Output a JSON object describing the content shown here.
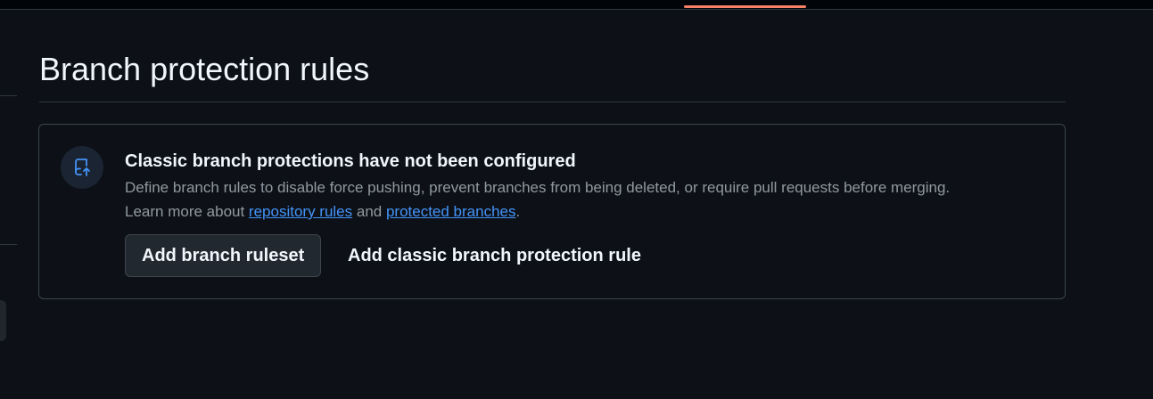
{
  "page": {
    "title": "Branch protection rules"
  },
  "empty_state": {
    "icon": "repo-push-icon",
    "title": "Classic branch protections have not been configured",
    "description": "Define branch rules to disable force pushing, prevent branches from being deleted, or require pull requests before merging.",
    "learn_more_prefix": "Learn more about ",
    "link_repository_rules": "repository rules",
    "learn_more_middle": " and ",
    "link_protected_branches": "protected branches",
    "learn_more_suffix": "."
  },
  "actions": {
    "add_ruleset_label": "Add branch ruleset",
    "add_classic_rule_label": "Add classic branch protection rule"
  },
  "colors": {
    "background": "#0d1117",
    "accent_underline": "#f78166",
    "link": "#4493f8",
    "icon": "#4493f8"
  }
}
